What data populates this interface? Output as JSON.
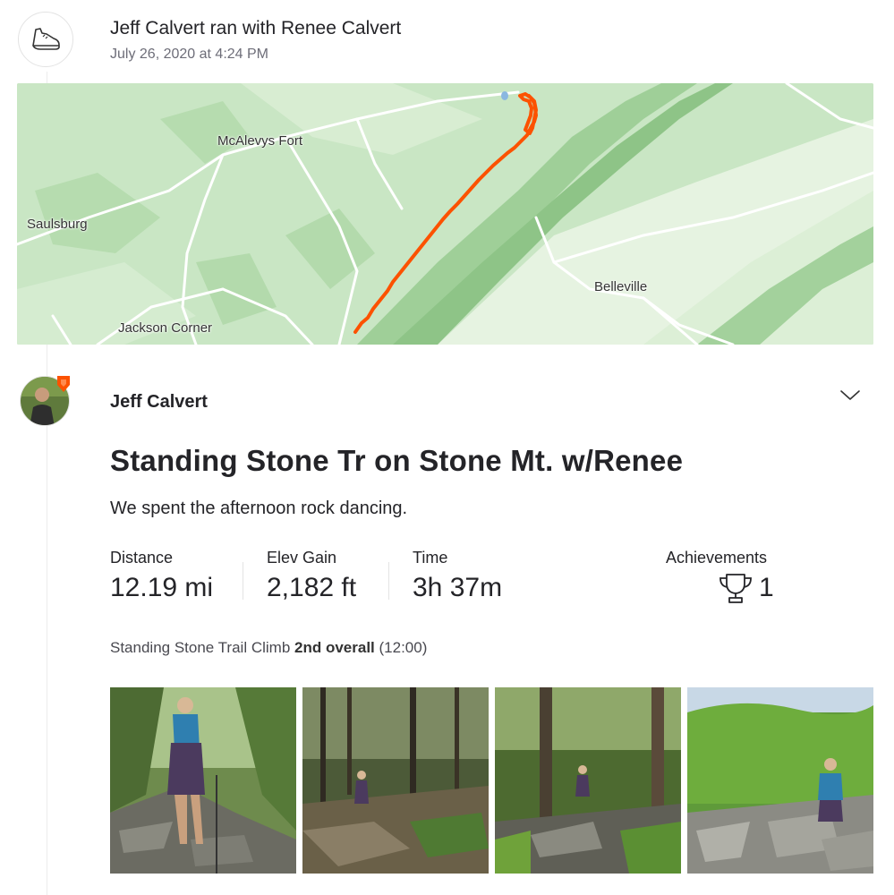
{
  "feed_header": {
    "title": "Jeff Calvert ran with Renee Calvert",
    "date": "July 26, 2020 at 4:24 PM",
    "icon": "shoe-icon"
  },
  "map": {
    "labels": {
      "mcalevys_fort": "McAlevys Fort",
      "saulsburg": "Saulsburg",
      "belleville": "Belleville",
      "jackson_corner": "Jackson Corner"
    },
    "colors": {
      "route": "#fc5200",
      "land": "#c9e6c4",
      "ridge": "#a8d3a0",
      "road": "#ffffff"
    }
  },
  "athlete": {
    "name": "Jeff Calvert",
    "badge_color": "#fc5200"
  },
  "activity": {
    "title": "Standing Stone Tr on Stone Mt. w/Renee",
    "description": "We spent the afternoon rock dancing.",
    "stats": {
      "distance": {
        "label": "Distance",
        "value": "12.19 mi"
      },
      "elev_gain": {
        "label": "Elev Gain",
        "value": "2,182 ft"
      },
      "time": {
        "label": "Time",
        "value": "3h 37m"
      },
      "achievements": {
        "label": "Achievements",
        "value": "1",
        "icon": "trophy-icon"
      }
    },
    "segment": {
      "name": "Standing Stone Trail Climb",
      "rank": "2nd overall",
      "time": "(12:00)"
    }
  },
  "photos": [
    {
      "name": "photo-1"
    },
    {
      "name": "photo-2"
    },
    {
      "name": "photo-3"
    },
    {
      "name": "photo-4"
    }
  ]
}
